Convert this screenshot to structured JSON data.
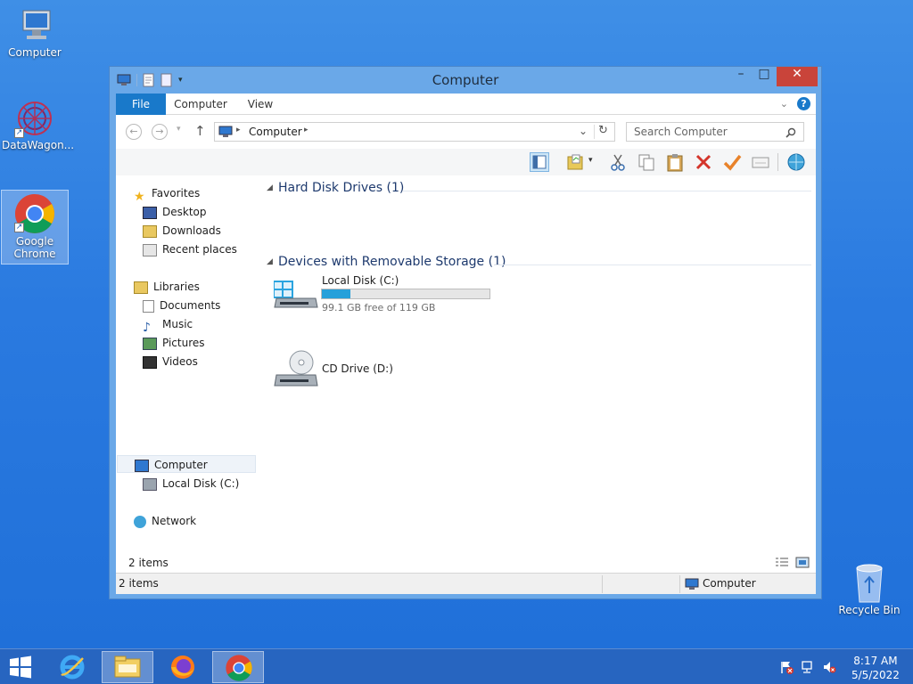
{
  "desktop": {
    "icons": [
      {
        "label": "Computer"
      },
      {
        "label": "DataWagon..."
      },
      {
        "label": "Google Chrome"
      },
      {
        "label": "Recycle Bin"
      }
    ]
  },
  "window": {
    "title": "Computer",
    "tabs": {
      "file": "File",
      "computer": "Computer",
      "view": "View"
    },
    "address": {
      "segment": "Computer"
    },
    "search_placeholder": "Search Computer",
    "nav_pane": {
      "favorites": "Favorites",
      "desktop": "Desktop",
      "downloads": "Downloads",
      "recent": "Recent places",
      "libraries": "Libraries",
      "documents": "Documents",
      "music": "Music",
      "pictures": "Pictures",
      "videos": "Videos",
      "computer": "Computer",
      "local_disk": "Local Disk (C:)",
      "network": "Network"
    },
    "groups": {
      "hard_disks": {
        "header": "Hard Disk Drives (1)"
      },
      "removable": {
        "header": "Devices with Removable Storage (1)"
      }
    },
    "drives": {
      "c": {
        "name": "Local Disk (C:)",
        "free_text": "99.1 GB free of 119 GB",
        "used_fraction": 0.17
      },
      "d": {
        "name": "CD Drive (D:)"
      }
    },
    "item_count": "2 items",
    "status": {
      "left": "2 items",
      "right": "Computer"
    }
  },
  "taskbar": {
    "clock_time": "8:17 AM",
    "clock_date": "5/5/2022"
  },
  "colors": {
    "accent": "#1979ca",
    "close": "#c9443a",
    "drive_fill": "#26a0da"
  }
}
